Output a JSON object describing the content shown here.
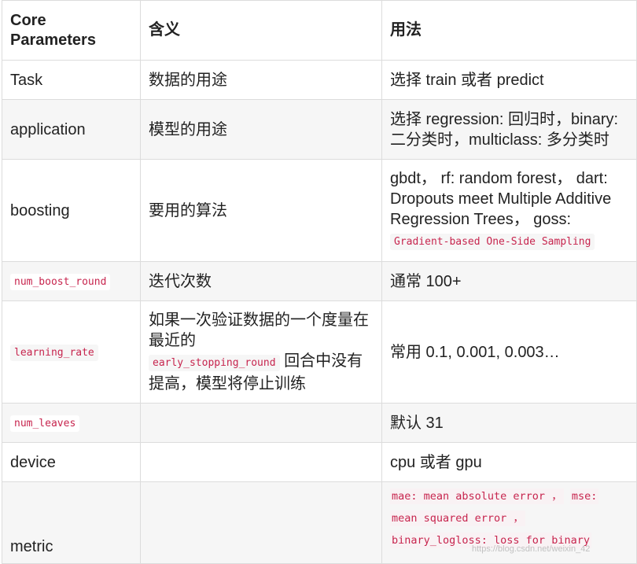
{
  "table": {
    "headers": [
      "Core Parameters",
      "含义",
      "用法"
    ],
    "rows": [
      {
        "param": "Task",
        "meaning": "数据的用途",
        "usage": "选择 train 或者 predict"
      },
      {
        "param": "application",
        "meaning": "模型的用途",
        "usage": "选择 regression: 回归时，binary: 二分类时，multiclass: 多分类时"
      },
      {
        "param": "boosting",
        "meaning": "要用的算法",
        "usage_text": "gbdt， rf: random forest， dart: Dropouts meet Multiple Additive Regression Trees， goss:",
        "usage_code": "Gradient-based One-Side Sampling"
      },
      {
        "param": "num_boost_round",
        "meaning": "迭代次数",
        "usage": "通常 100+"
      },
      {
        "param": "learning_rate",
        "meaning_pre": "如果一次验证数据的一个度量在最近的",
        "meaning_code": "early_stopping_round",
        "meaning_post": "回合中没有提高，模型将停止训练",
        "usage": "常用 0.1, 0.001, 0.003…"
      },
      {
        "param": "num_leaves",
        "meaning": "",
        "usage": "默认 31"
      },
      {
        "param": "device",
        "meaning": "",
        "usage": "cpu 或者 gpu"
      },
      {
        "param": "metric",
        "meaning": "",
        "usage_code_1": "mae: mean absolute error ，",
        "usage_code_2": "mse:",
        "usage_code_3": "mean squared error ，",
        "usage_code_4": "binary_logloss: loss for binary"
      }
    ]
  },
  "watermark": "https://blog.csdn.net/weixin_42"
}
